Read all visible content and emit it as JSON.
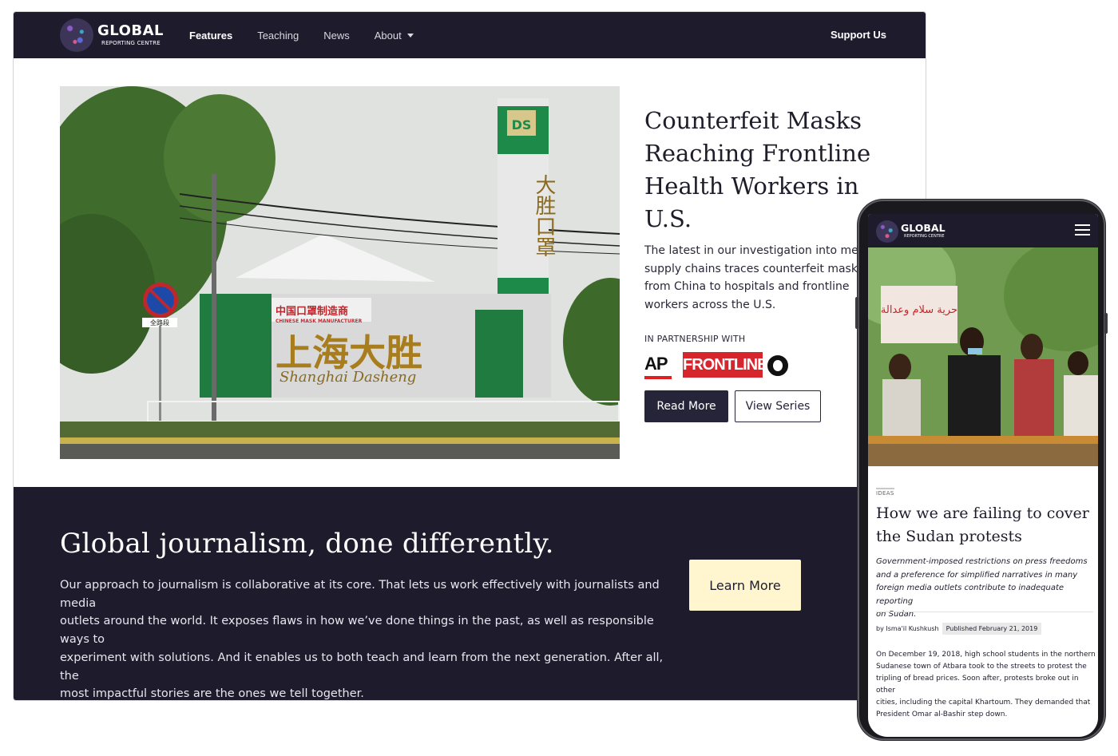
{
  "desktop": {
    "logo": {
      "title": "GLOBAL",
      "subtitle": "REPORTING CENTRE"
    },
    "nav": {
      "items": [
        {
          "label": "Features"
        },
        {
          "label": "Teaching"
        },
        {
          "label": "News"
        },
        {
          "label": "About"
        }
      ],
      "support_label": "Support Us"
    },
    "hero": {
      "image_signs": {
        "red_sign": "中国口罩制造商",
        "red_sign_en": "CHINESE MASK MANUFACTURER",
        "big_chars": "上海大胜",
        "script": "Shanghai Dasheng",
        "tower_chars": "大胜口罩",
        "small_sign": "全路段",
        "badge": "DS"
      },
      "title": "Counterfeit Masks Reaching Frontline Health Workers in U.S.",
      "description_lines": [
        "The latest in our investigation into medic",
        "supply chains traces counterfeit masks",
        "from China to hospitals and frontline",
        "workers across the U.S."
      ],
      "partnership_label": "IN PARTNERSHIP WITH",
      "partners": {
        "ap": "AP",
        "frontline": "FRONTLINE"
      },
      "read_more": "Read More",
      "view_series": "View Series"
    },
    "band": {
      "title": "Global journalism, done differently.",
      "text_lines": [
        "Our approach to journalism is collaborative at its core. That lets us work effectively with journalists and media",
        "outlets around the world. It exposes flaws in how we’ve done things in the past, as well as responsible ways to",
        "experiment with solutions. And it enables us to both teach and learn from the next generation. After all, the",
        "most impactful stories are the ones we tell together."
      ],
      "learn_more": "Learn More"
    }
  },
  "mobile": {
    "logo": {
      "title": "GLOBAL",
      "subtitle": "REPORTING CENTRE"
    },
    "image_sign_text": "حرية سلام وعدالة",
    "tag": "IDEAS",
    "title_lines": [
      "How we are failing to cover",
      "the Sudan protests"
    ],
    "dek_lines": [
      "Government-imposed restrictions on press freedoms",
      "and a preference for simplified narratives in many",
      "foreign media outlets contribute to inadequate reporting",
      "on Sudan."
    ],
    "byline": "by Isma'il Kushkush",
    "published": "Published February 21, 2019",
    "paragraph_lines": [
      "On December 19, 2018, high school students in the northern",
      "Sudanese town of Atbara took to the streets to protest the",
      "tripling of bread prices. Soon after, protests broke out in other",
      "cities, including the capital Khartoum. They demanded that",
      "President Omar al-Bashir step down."
    ]
  }
}
